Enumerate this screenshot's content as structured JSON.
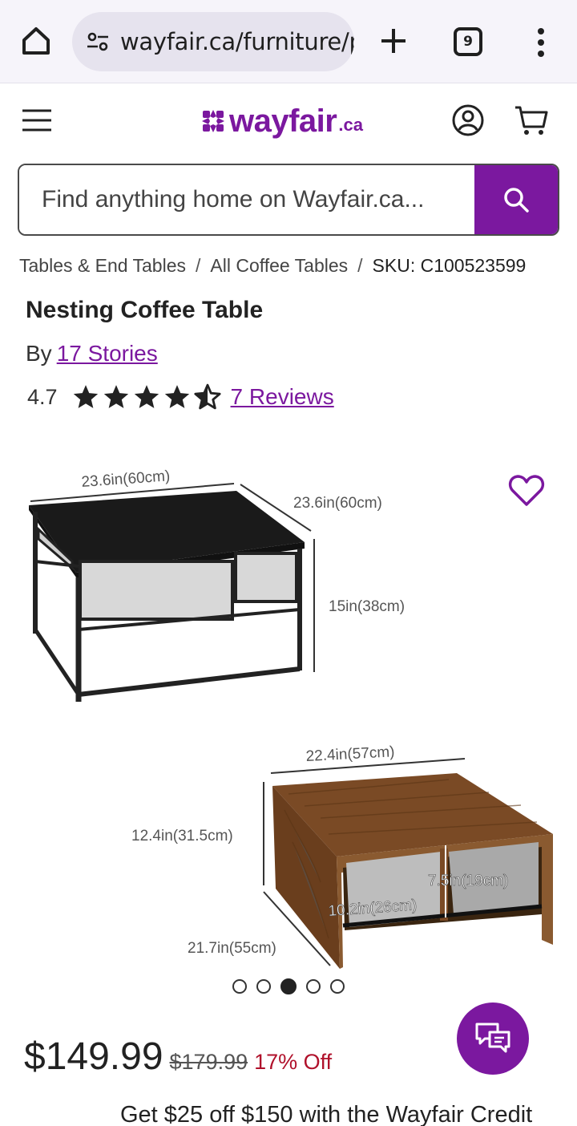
{
  "browser": {
    "url": "wayfair.ca/furniture/p",
    "tab_count": "9"
  },
  "header": {
    "logo_word": "wayfair",
    "logo_tld": ".ca"
  },
  "search": {
    "placeholder": "Find anything home on Wayfair.ca..."
  },
  "breadcrumb": {
    "items": [
      "Tables & End Tables",
      "All Coffee Tables"
    ],
    "separator": "/",
    "sku": "SKU: C100523599"
  },
  "product": {
    "title": "Nesting Coffee Table",
    "by_label": "By",
    "brand": "17 Stories",
    "rating": "4.7",
    "rating_value": 4.7,
    "rating_max": 5,
    "reviews_label": "7 Reviews"
  },
  "image_labels": {
    "small_width": "23.6in(60cm)",
    "small_depth": "23.6in(60cm)",
    "small_height": "15in(38cm)",
    "large_width": "22.4in(57cm)",
    "large_height": "12.4in(31.5cm)",
    "large_depth": "21.7in(55cm)",
    "inner_height": "7.5in(19cm)",
    "inner_depth": "10.2in(26cm)"
  },
  "carousel": {
    "count": 5,
    "active_index": 2
  },
  "pricing": {
    "current": "$149.99",
    "original": "$179.99",
    "discount": "17% Off"
  },
  "promo": {
    "credit_text": "Get $25 off $150 with the Wayfair Credit"
  },
  "colors": {
    "brand": "#7b189f",
    "discount": "#b0112b"
  },
  "icons": [
    "home-icon",
    "site-settings-icon",
    "new-tab-icon",
    "tab-switcher-icon",
    "more-options-icon",
    "menu-icon",
    "account-icon",
    "cart-icon",
    "search-icon",
    "star-icon",
    "heart-icon",
    "chat-icon"
  ]
}
